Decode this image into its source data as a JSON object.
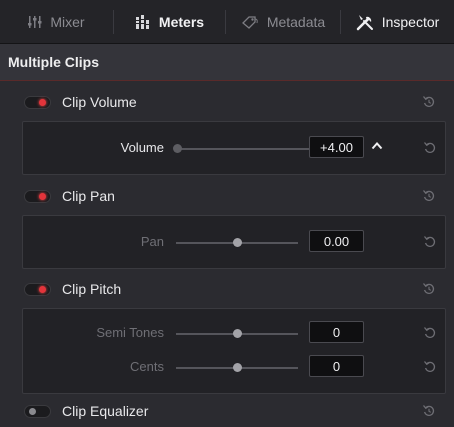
{
  "tabs": [
    {
      "label": "Mixer",
      "icon": "mixer-icon",
      "active": false
    },
    {
      "label": "Meters",
      "icon": "meters-icon",
      "active": true
    },
    {
      "label": "Metadata",
      "icon": "metadata-tag-icon",
      "active": false
    },
    {
      "label": "Inspector",
      "icon": "inspector-tools-icon",
      "active": true
    }
  ],
  "section": {
    "title": "Multiple Clips"
  },
  "groups": {
    "clip_volume": {
      "label": "Clip Volume",
      "enabled": true
    },
    "clip_pan": {
      "label": "Clip Pan",
      "enabled": true
    },
    "clip_pitch": {
      "label": "Clip Pitch",
      "enabled": true
    },
    "clip_equalizer": {
      "label": "Clip Equalizer",
      "enabled": false
    }
  },
  "params": {
    "volume": {
      "label": "Volume",
      "value": "+4.00"
    },
    "pan": {
      "label": "Pan",
      "value": "0.00"
    },
    "semitones": {
      "label": "Semi Tones",
      "value": "0"
    },
    "cents": {
      "label": "Cents",
      "value": "0"
    }
  },
  "colors": {
    "accent_on": "#e3343b",
    "background": "#2b2b30",
    "panel": "#222226"
  }
}
